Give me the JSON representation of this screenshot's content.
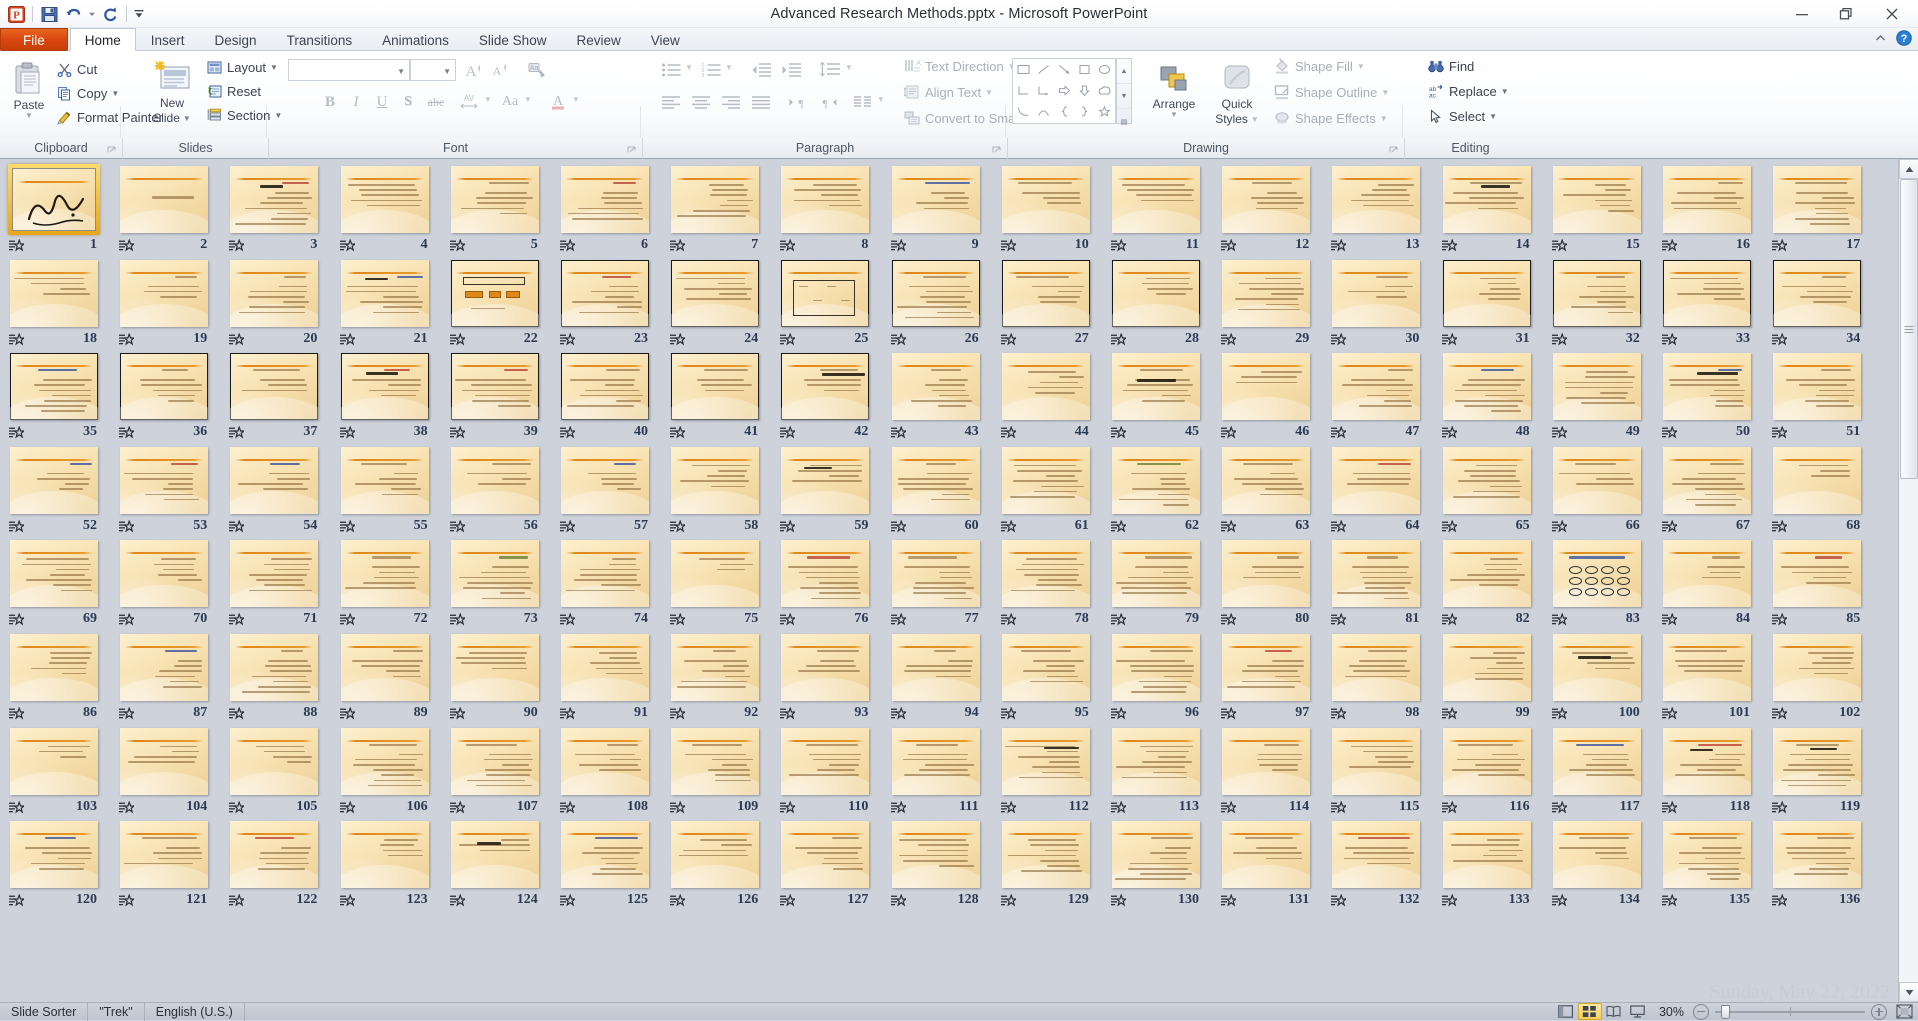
{
  "window": {
    "title": "Advanced Research Methods.pptx  -  Microsoft PowerPoint",
    "minimize": "Minimize",
    "maximize": "Restore Down",
    "close": "Close"
  },
  "qat": {
    "app_icon": "powerpoint-icon",
    "items": [
      {
        "name": "save-icon",
        "label": "Save"
      },
      {
        "name": "undo-icon",
        "label": "Undo"
      },
      {
        "name": "undo-dropdown-icon",
        "label": "Undo options"
      },
      {
        "name": "redo-icon",
        "label": "Repeat"
      },
      {
        "name": "customize-qat-icon",
        "label": "Customize Quick Access Toolbar"
      }
    ]
  },
  "tabs": [
    {
      "label": "File",
      "kind": "file"
    },
    {
      "label": "Home",
      "kind": "active"
    },
    {
      "label": "Insert",
      "kind": "normal"
    },
    {
      "label": "Design",
      "kind": "normal"
    },
    {
      "label": "Transitions",
      "kind": "normal"
    },
    {
      "label": "Animations",
      "kind": "normal"
    },
    {
      "label": "Slide Show",
      "kind": "normal"
    },
    {
      "label": "Review",
      "kind": "normal"
    },
    {
      "label": "View",
      "kind": "normal"
    }
  ],
  "ribbon_right": {
    "minimize_ribbon": "Minimize the Ribbon",
    "help": "Microsoft PowerPoint Help"
  },
  "groups": [
    {
      "label": "Clipboard",
      "dialog_launcher": true
    },
    {
      "label": "Slides",
      "dialog_launcher": false
    },
    {
      "label": "Font",
      "dialog_launcher": true
    },
    {
      "label": "Paragraph",
      "dialog_launcher": true
    },
    {
      "label": "Drawing",
      "dialog_launcher": true
    },
    {
      "label": "Editing",
      "dialog_launcher": false
    }
  ],
  "clipboard": {
    "paste": "Paste",
    "cut": "Cut",
    "copy": "Copy",
    "format_painter": "Format Painter"
  },
  "slides_group": {
    "new_slide": "New\nSlide",
    "new_slide_line1": "New",
    "new_slide_line2": "Slide",
    "layout": "Layout",
    "reset": "Reset",
    "section": "Section"
  },
  "font_group": {
    "font_name_value": "",
    "font_size_value": "",
    "grow_font": "Increase Font Size",
    "shrink_font": "Decrease Font Size",
    "clear_formatting": "Clear All Formatting",
    "bold": "B",
    "italic": "I",
    "underline": "U",
    "shadow": "S",
    "strikethrough": "abc",
    "character_spacing": "AV",
    "change_case": "Aa",
    "font_color": "A"
  },
  "paragraph_group": {
    "bullets": "Bullets",
    "numbering": "Numbering",
    "decrease_indent": "Decrease List Level",
    "increase_indent": "Increase List Level",
    "line_spacing": "Line Spacing",
    "align_left": "Align Text Left",
    "align_center": "Center",
    "align_right": "Align Text Right",
    "justify": "Justify",
    "columns": "Columns",
    "ltr": "Left-to-Right",
    "rtl": "Right-to-Left",
    "text_direction": "Text Direction",
    "align_text": "Align Text",
    "convert_smartart": "Convert to SmartArt"
  },
  "drawing_group": {
    "arrange": "Arrange",
    "quick_styles_line1": "Quick",
    "quick_styles_line2": "Styles",
    "shape_fill": "Shape Fill",
    "shape_outline": "Shape Outline",
    "shape_effects": "Shape Effects"
  },
  "editing_group": {
    "find": "Find",
    "replace": "Replace",
    "select": "Select"
  },
  "sorter": {
    "columns": 17,
    "selected_slide": 1,
    "total_visible_rows": 8,
    "slide_numbers_row1": [
      1,
      2,
      3,
      4,
      5,
      6,
      7,
      8,
      9,
      10,
      11,
      12,
      13,
      14,
      15,
      16,
      17
    ],
    "slide_numbers_row2": [
      18,
      19,
      20,
      21,
      22,
      23,
      24,
      25,
      26,
      27,
      28,
      29,
      30,
      31,
      32,
      33,
      34
    ],
    "slide_numbers_row3": [
      35,
      36,
      37,
      38,
      39,
      40,
      41,
      42,
      43,
      44,
      45,
      46,
      47,
      48,
      49,
      50,
      51
    ],
    "slide_numbers_row4": [
      52,
      53,
      54,
      55,
      56,
      57,
      58,
      59,
      60,
      61,
      62,
      63,
      64,
      65,
      66,
      67,
      68
    ],
    "slide_numbers_row5": [
      69,
      70,
      71,
      72,
      73,
      74,
      75,
      76,
      77,
      78,
      79,
      80,
      81,
      82,
      83,
      84,
      85
    ],
    "slide_numbers_row6": [
      86,
      87,
      88,
      89,
      90,
      91,
      92,
      93,
      94,
      95,
      96,
      97,
      98,
      99,
      100,
      101,
      102
    ],
    "slide_numbers_row7": [
      103,
      104,
      105,
      106,
      107,
      108,
      109,
      110,
      111,
      112,
      113,
      114,
      115,
      116,
      117,
      118,
      119
    ],
    "slide_numbers_row8": [
      120,
      121,
      122,
      123,
      124,
      125,
      126,
      127,
      128,
      129,
      130,
      131,
      132,
      133,
      134,
      135,
      136
    ],
    "bordered_slides": [
      22,
      23,
      24,
      25,
      26,
      27,
      28,
      31,
      32,
      33,
      34,
      35,
      36,
      37,
      38,
      39,
      40,
      41,
      42
    ],
    "animation_icon": "animation-star-icon"
  },
  "status": {
    "view_name": "Slide Sorter",
    "theme_name": "\"Trek\"",
    "language": "English (U.S.)",
    "zoom_percent": "30%",
    "views": [
      {
        "name": "normal-view-button",
        "label": "Normal",
        "active": false
      },
      {
        "name": "slide-sorter-view-button",
        "label": "Slide Sorter",
        "active": true
      },
      {
        "name": "reading-view-button",
        "label": "Reading View",
        "active": false
      },
      {
        "name": "slide-show-button",
        "label": "Slide Show",
        "active": false
      }
    ],
    "zoom_out": "Zoom Out",
    "zoom_in": "Zoom In",
    "fit_to_window": "Fit slide to current window"
  },
  "watermark": {
    "text": "Sunday, May 22, 2022"
  }
}
